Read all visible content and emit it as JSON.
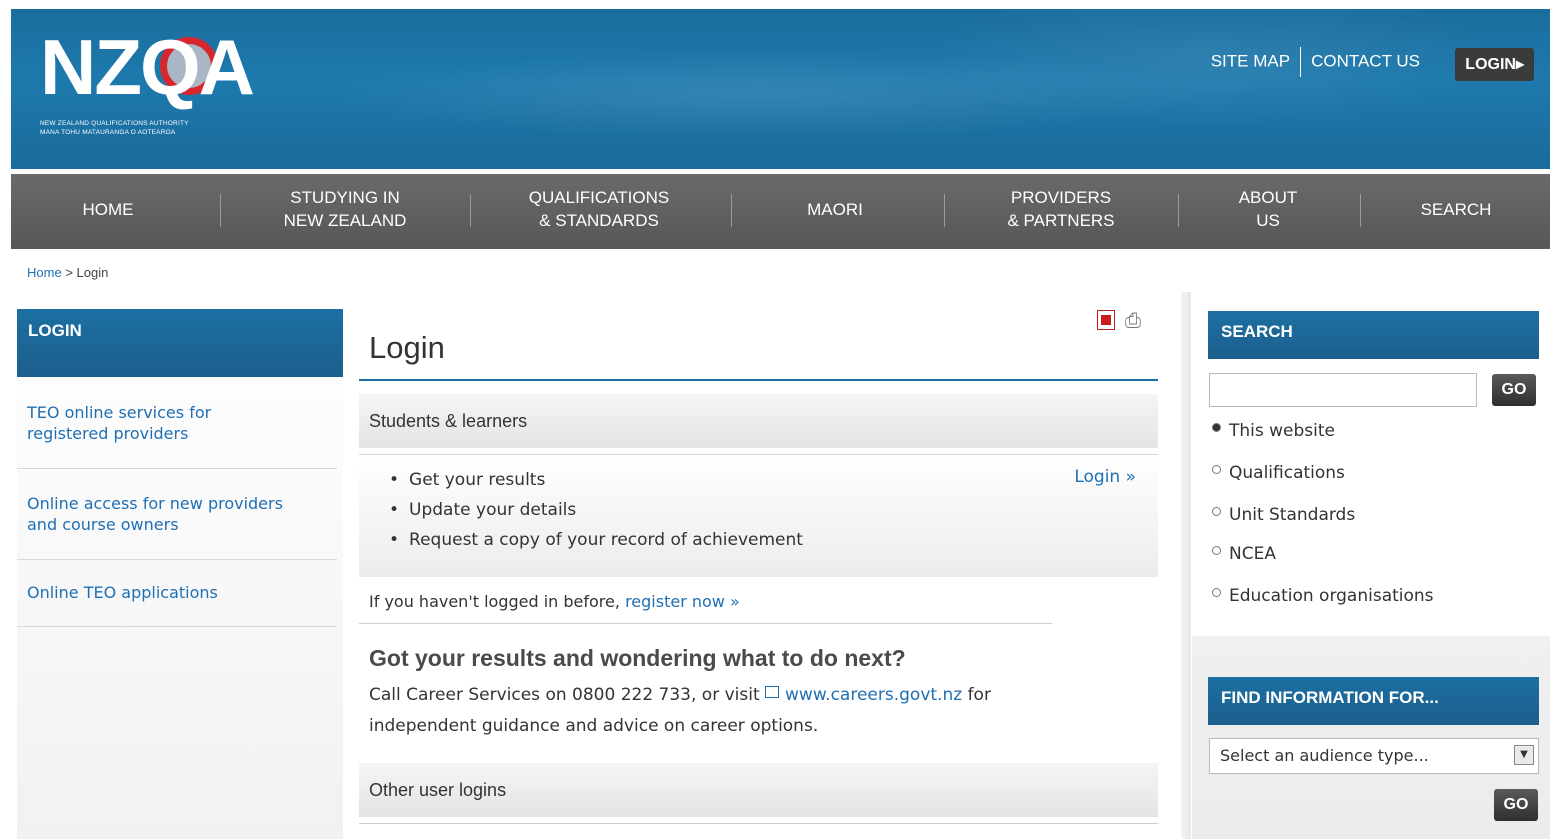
{
  "header": {
    "logo_text": "NZQA",
    "logo_sub_line1": "NEW ZEALAND QUALIFICATIONS AUTHORITY",
    "logo_sub_line2": "MANA TOHU MATAURANGA O AOTEAROA",
    "site_map": "SITE MAP",
    "contact_us": "CONTACT US",
    "login_button": "LOGIN▸"
  },
  "nav": {
    "items": [
      {
        "line1": "HOME",
        "line2": ""
      },
      {
        "line1": "STUDYING IN",
        "line2": "NEW ZEALAND"
      },
      {
        "line1": "QUALIFICATIONS",
        "line2": "& STANDARDS"
      },
      {
        "line1": "MAORI",
        "line2": ""
      },
      {
        "line1": "PROVIDERS",
        "line2": "& PARTNERS"
      },
      {
        "line1": "ABOUT",
        "line2": "US"
      },
      {
        "line1": "SEARCH",
        "line2": ""
      }
    ]
  },
  "breadcrumb": {
    "home": "Home",
    "separator": ">",
    "current": "Login"
  },
  "left": {
    "heading": "LOGIN",
    "links": [
      {
        "line1": "TEO online services for",
        "line2": "registered providers"
      },
      {
        "line1": "Online access for new providers",
        "line2": "and course owners"
      },
      {
        "line1": "Online TEO applications",
        "line2": ""
      }
    ]
  },
  "main": {
    "title": "Login",
    "students_heading": "Students & learners",
    "bullets": [
      "Get your results",
      "Update your details",
      "Request a copy of your record of achievement"
    ],
    "login_link": "Login »",
    "register_prefix": "If you haven't logged in before,",
    "register_link": "register now »",
    "results_heading": "Got your results and wondering what to do next?",
    "results_body_prefix": "Call Career Services on 0800 222 733, or visit",
    "results_link": "www.careers.govt.nz",
    "results_body_suffix": "for",
    "results_body_line2": "independent guidance and advice on career options.",
    "other_heading": "Other user logins"
  },
  "right": {
    "search_heading": "SEARCH",
    "search_placeholder": "",
    "go_label": "GO",
    "radios": [
      {
        "label": "This website",
        "checked": true
      },
      {
        "label": "Qualifications",
        "checked": false
      },
      {
        "label": "Unit Standards",
        "checked": false
      },
      {
        "label": "NCEA",
        "checked": false
      },
      {
        "label": "Education organisations",
        "checked": false
      }
    ],
    "find_heading": "FIND INFORMATION FOR...",
    "audience_selected": "Select an audience type...",
    "go2_label": "GO"
  },
  "colors": {
    "brand_blue": "#1d6fa3",
    "nav_gray": "#5f5f5f",
    "link_blue": "#1f6fb4",
    "logo_red": "#d8262e"
  },
  "icons": [
    "pdf-icon",
    "print-icon",
    "external-link-icon",
    "dropdown-arrow-icon"
  ]
}
